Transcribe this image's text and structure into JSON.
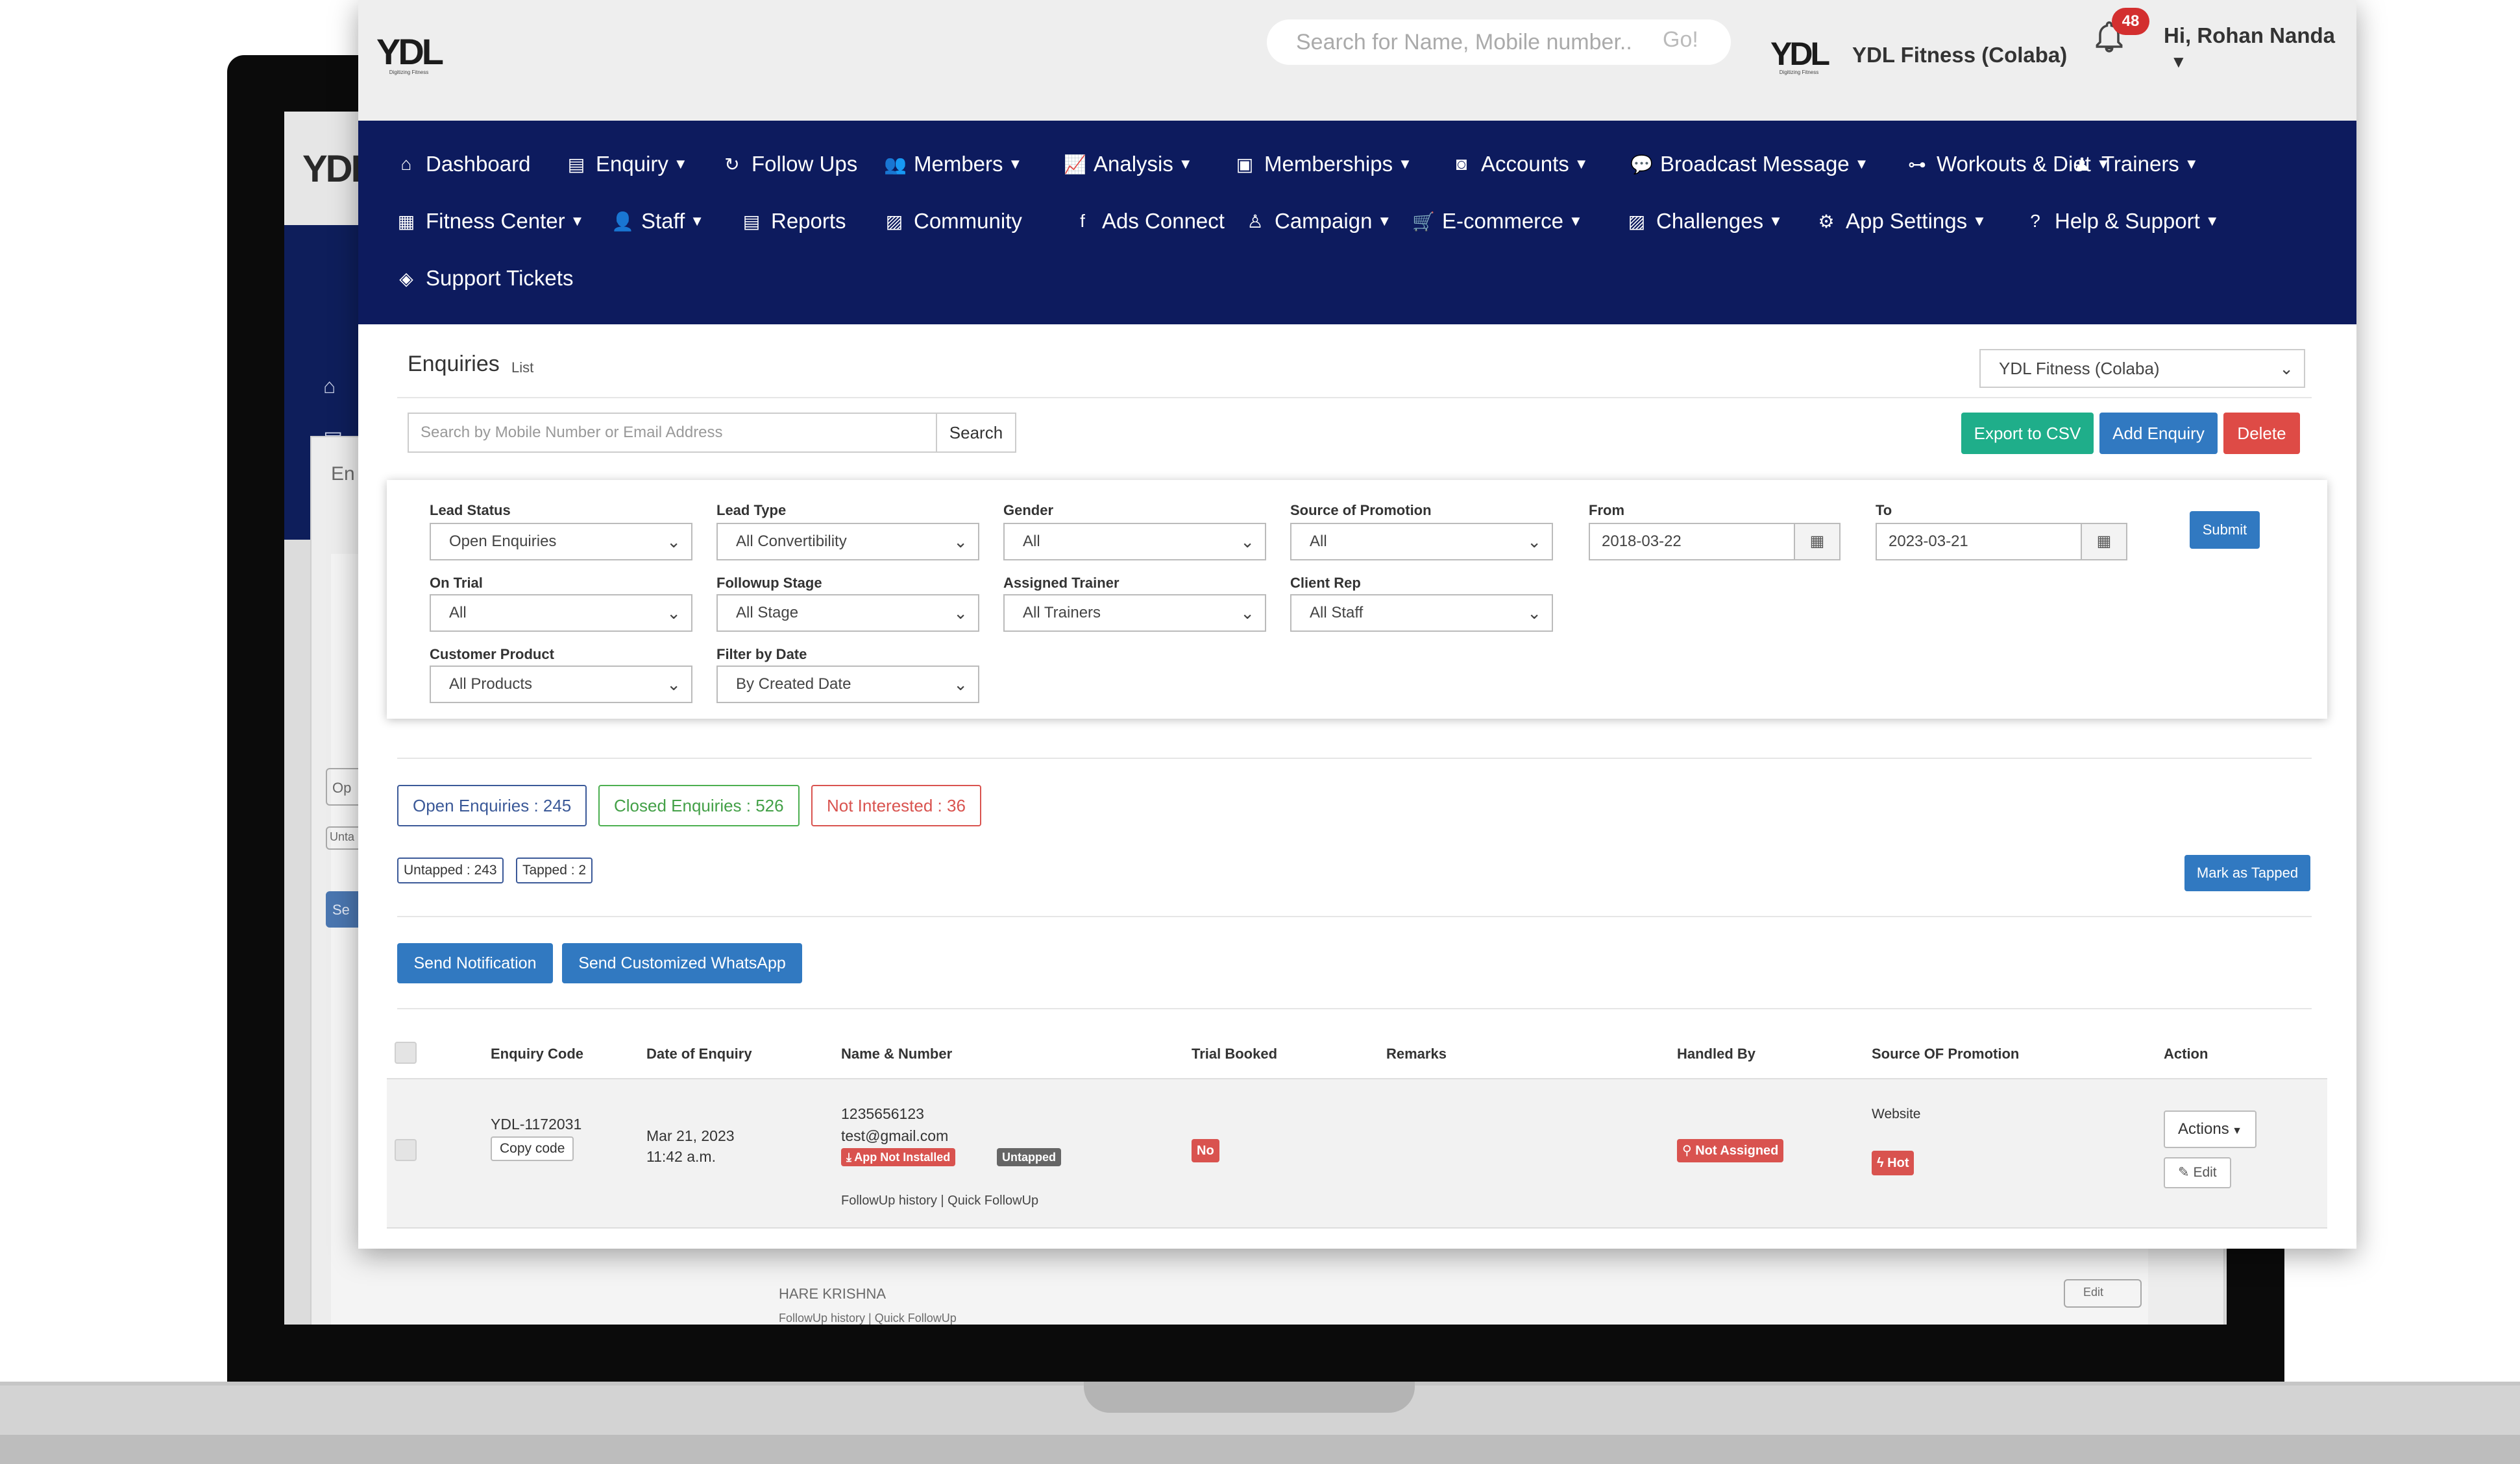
{
  "background_app": {
    "items": [
      "Op",
      "Unta",
      "Se",
      "En"
    ],
    "follow_up_links": "FollowUp history | Quick FollowUp",
    "name_text": "HARE KRISHNA",
    "edit_label": "Edit"
  },
  "header": {
    "logo_text": "YDL",
    "logo_tagline": "Digitizing Fitness",
    "search_placeholder": "Search for Name, Mobile number..",
    "go_label": "Go!",
    "branch_name": "YDL Fitness (Colaba)",
    "notification_count": "48",
    "user_greeting": "Hi, Rohan Nanda"
  },
  "nav": {
    "row1": [
      {
        "label": "Dashboard",
        "icon": "home-icon",
        "glyph": "⌂",
        "caret": false
      },
      {
        "label": "Enquiry",
        "icon": "file-icon",
        "glyph": "▤",
        "caret": true
      },
      {
        "label": "Follow Ups",
        "icon": "refresh-icon",
        "glyph": "↻",
        "caret": false
      },
      {
        "label": "Members",
        "icon": "users-icon",
        "glyph": "👥",
        "caret": true
      },
      {
        "label": "Analysis",
        "icon": "chart-icon",
        "glyph": "📈",
        "caret": true
      },
      {
        "label": "Memberships",
        "icon": "card-icon",
        "glyph": "▣",
        "caret": true
      },
      {
        "label": "Accounts",
        "icon": "money-icon",
        "glyph": "◙",
        "caret": true
      },
      {
        "label": "Broadcast Message",
        "icon": "chat-icon",
        "glyph": "💬",
        "caret": true
      },
      {
        "label": "Workouts & Diet",
        "icon": "dumbbell-icon",
        "glyph": "⊶",
        "caret": true
      },
      {
        "label": "Trainers",
        "icon": "trainer-icon",
        "glyph": "♟",
        "caret": true
      }
    ],
    "row2": [
      {
        "label": "Fitness Center",
        "icon": "building-icon",
        "glyph": "▦",
        "caret": true
      },
      {
        "label": "Staff",
        "icon": "user-icon",
        "glyph": "👤",
        "caret": true
      },
      {
        "label": "Reports",
        "icon": "report-icon",
        "glyph": "▤",
        "caret": false
      },
      {
        "label": "Community",
        "icon": "image-icon",
        "glyph": "▨",
        "caret": false
      },
      {
        "label": "Ads Connect",
        "icon": "facebook-icon",
        "glyph": "f",
        "caret": false
      },
      {
        "label": "Campaign",
        "icon": "person-icon",
        "glyph": "♙",
        "caret": true
      },
      {
        "label": "E-commerce",
        "icon": "cart-icon",
        "glyph": "🛒",
        "caret": true
      },
      {
        "label": "Challenges",
        "icon": "picture-icon",
        "glyph": "▨",
        "caret": true
      },
      {
        "label": "App Settings",
        "icon": "gear-icon",
        "glyph": "⚙",
        "caret": true
      },
      {
        "label": "Help & Support",
        "icon": "question-icon",
        "glyph": "?",
        "caret": true
      }
    ],
    "row3": [
      {
        "label": "Support Tickets",
        "icon": "tag-icon",
        "glyph": "◈",
        "caret": false
      }
    ]
  },
  "page": {
    "title": "Enquiries",
    "subtitle": "List",
    "branch_select": "YDL Fitness (Colaba)",
    "search_placeholder": "Search by Mobile Number or Email Address",
    "search_label": "Search",
    "export_label": "Export to CSV",
    "add_label": "Add Enquiry",
    "delete_label": "Delete"
  },
  "filters": {
    "lead_status": {
      "label": "Lead Status",
      "value": "Open Enquiries"
    },
    "lead_type": {
      "label": "Lead Type",
      "value": "All Convertibility"
    },
    "gender": {
      "label": "Gender",
      "value": "All"
    },
    "source": {
      "label": "Source of Promotion",
      "value": "All"
    },
    "from": {
      "label": "From",
      "value": "2018-03-22"
    },
    "to": {
      "label": "To",
      "value": "2023-03-21"
    },
    "submit_label": "Submit",
    "on_trial": {
      "label": "On Trial",
      "value": "All"
    },
    "followup_stage": {
      "label": "Followup Stage",
      "value": "All Stage"
    },
    "assigned_trainer": {
      "label": "Assigned Trainer",
      "value": "All Trainers"
    },
    "client_rep": {
      "label": "Client Rep",
      "value": "All Staff"
    },
    "customer_product": {
      "label": "Customer Product",
      "value": "All Products"
    },
    "filter_by_date": {
      "label": "Filter by Date",
      "value": "By Created Date"
    }
  },
  "counts": {
    "open": "Open Enquiries : 245",
    "closed": "Closed Enquiries : 526",
    "not_interested": "Not Interested : 36",
    "untapped": "Untapped : 243",
    "tapped": "Tapped : 2",
    "mark_tapped_label": "Mark as Tapped"
  },
  "actions": {
    "send_notification": "Send Notification",
    "send_whatsapp": "Send Customized WhatsApp"
  },
  "table": {
    "headers": [
      "Enquiry Code",
      "Date of Enquiry",
      "Name & Number",
      "Trial Booked",
      "Remarks",
      "Handled By",
      "Source OF Promotion",
      "Action"
    ],
    "rows": [
      {
        "code": "YDL-1172031",
        "copy_label": "Copy code",
        "date": "Mar 21, 2023",
        "time": "11:42 a.m.",
        "phone": "1235656123",
        "email": "test@gmail.com",
        "app_status": "App Not Installed",
        "tap_status": "Untapped",
        "links": "FollowUp history | Quick FollowUp",
        "trial": "No",
        "handled_by": "Not Assigned",
        "source": "Website",
        "temperature": "Hot",
        "actions_label": "Actions",
        "edit_label": "Edit"
      }
    ]
  },
  "colors": {
    "navbar": "#0d1b5e",
    "primary": "#3179c1",
    "success": "#1fae8a",
    "danger": "#de4b46",
    "badge_red": "#d32f2f"
  }
}
